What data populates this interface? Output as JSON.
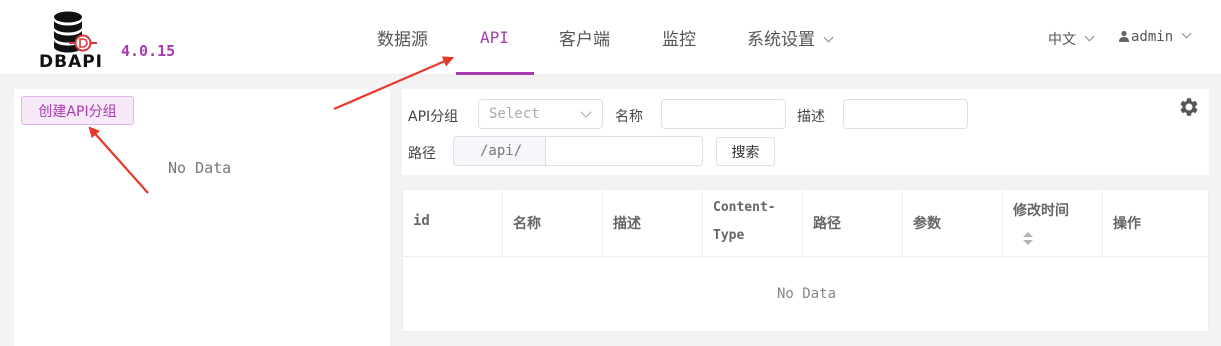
{
  "app": {
    "logo_text": "DBAPI",
    "version": "4.0.15",
    "brand_color": "#a63cb0"
  },
  "nav": {
    "items": [
      {
        "label": "数据源"
      },
      {
        "label": "API",
        "active": true
      },
      {
        "label": "客户端"
      },
      {
        "label": "监控"
      },
      {
        "label": "系统设置"
      }
    ]
  },
  "header_right": {
    "language": "中文",
    "user": "admin"
  },
  "left_panel": {
    "create_group_button": "创建API分组",
    "empty_text": "No Data"
  },
  "search": {
    "group_label": "API分组",
    "group_select_placeholder": "Select",
    "name_label": "名称",
    "name_value": "",
    "desc_label": "描述",
    "desc_value": "",
    "path_label": "路径",
    "path_prefix": "/api/",
    "path_value": "",
    "search_button": "搜索",
    "settings_icon": "gear-icon"
  },
  "table": {
    "columns": {
      "id": "id",
      "name": "名称",
      "desc": "描述",
      "content_type_line1": "Content-",
      "content_type_line2": "Type",
      "path": "路径",
      "params": "参数",
      "modified": "修改时间",
      "actions": "操作"
    },
    "empty_text": "No Data"
  }
}
